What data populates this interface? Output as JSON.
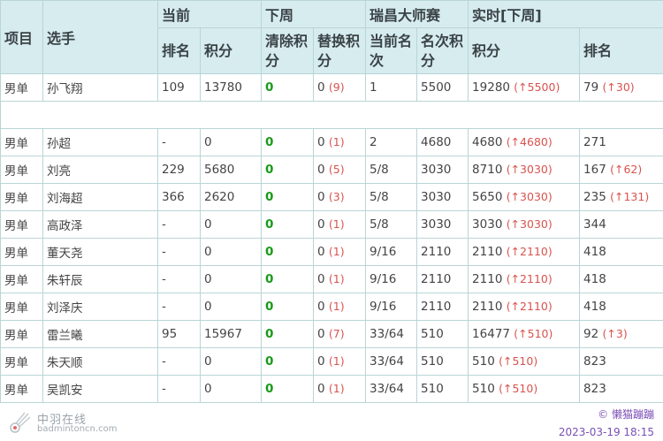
{
  "header": {
    "group_current": "当前",
    "group_nextweek": "下周",
    "group_tournament": "瑞昌大师赛",
    "group_realtime": "实时[下周]",
    "col_event": "项目",
    "col_player": "选手",
    "col_rank": "排名",
    "col_points": "积分",
    "col_clear": "清除积分",
    "col_replace": "替换积分",
    "col_curround": "当前名次",
    "col_roundpts": "名次积分",
    "col_rt_points": "积分",
    "col_rt_rank": "排名"
  },
  "rows": [
    {
      "event": "男单",
      "player": "孙飞翔",
      "rank": "109",
      "points": "13780",
      "clear": "0",
      "replace": "0",
      "replace_paren": "(9)",
      "round": "1",
      "round_pts": "5500",
      "rt_points": "19280",
      "rt_points_delta": "(↑5500)",
      "rt_rank": "79",
      "rt_rank_delta": "(↑30)"
    },
    {
      "event": "男单",
      "player": "孙超",
      "rank": "-",
      "points": "0",
      "clear": "0",
      "replace": "0",
      "replace_paren": "(1)",
      "round": "2",
      "round_pts": "4680",
      "rt_points": "4680",
      "rt_points_delta": "(↑4680)",
      "rt_rank": "271",
      "rt_rank_delta": ""
    },
    {
      "event": "男单",
      "player": "刘亮",
      "rank": "229",
      "points": "5680",
      "clear": "0",
      "replace": "0",
      "replace_paren": "(5)",
      "round": "5/8",
      "round_pts": "3030",
      "rt_points": "8710",
      "rt_points_delta": "(↑3030)",
      "rt_rank": "167",
      "rt_rank_delta": "(↑62)"
    },
    {
      "event": "男单",
      "player": "刘海超",
      "rank": "366",
      "points": "2620",
      "clear": "0",
      "replace": "0",
      "replace_paren": "(3)",
      "round": "5/8",
      "round_pts": "3030",
      "rt_points": "5650",
      "rt_points_delta": "(↑3030)",
      "rt_rank": "235",
      "rt_rank_delta": "(↑131)"
    },
    {
      "event": "男单",
      "player": "高政泽",
      "rank": "-",
      "points": "0",
      "clear": "0",
      "replace": "0",
      "replace_paren": "(1)",
      "round": "5/8",
      "round_pts": "3030",
      "rt_points": "3030",
      "rt_points_delta": "(↑3030)",
      "rt_rank": "344",
      "rt_rank_delta": ""
    },
    {
      "event": "男单",
      "player": "董天尧",
      "rank": "-",
      "points": "0",
      "clear": "0",
      "replace": "0",
      "replace_paren": "(1)",
      "round": "9/16",
      "round_pts": "2110",
      "rt_points": "2110",
      "rt_points_delta": "(↑2110)",
      "rt_rank": "418",
      "rt_rank_delta": ""
    },
    {
      "event": "男单",
      "player": "朱轩辰",
      "rank": "-",
      "points": "0",
      "clear": "0",
      "replace": "0",
      "replace_paren": "(1)",
      "round": "9/16",
      "round_pts": "2110",
      "rt_points": "2110",
      "rt_points_delta": "(↑2110)",
      "rt_rank": "418",
      "rt_rank_delta": ""
    },
    {
      "event": "男单",
      "player": "刘泽庆",
      "rank": "-",
      "points": "0",
      "clear": "0",
      "replace": "0",
      "replace_paren": "(1)",
      "round": "9/16",
      "round_pts": "2110",
      "rt_points": "2110",
      "rt_points_delta": "(↑2110)",
      "rt_rank": "418",
      "rt_rank_delta": ""
    },
    {
      "event": "男单",
      "player": "雷兰曦",
      "rank": "95",
      "points": "15967",
      "clear": "0",
      "replace": "0",
      "replace_paren": "(7)",
      "round": "33/64",
      "round_pts": "510",
      "rt_points": "16477",
      "rt_points_delta": "(↑510)",
      "rt_rank": "92",
      "rt_rank_delta": "(↑3)"
    },
    {
      "event": "男单",
      "player": "朱天顺",
      "rank": "-",
      "points": "0",
      "clear": "0",
      "replace": "0",
      "replace_paren": "(1)",
      "round": "33/64",
      "round_pts": "510",
      "rt_points": "510",
      "rt_points_delta": "(↑510)",
      "rt_rank": "823",
      "rt_rank_delta": ""
    },
    {
      "event": "男单",
      "player": "吴凯安",
      "rank": "-",
      "points": "0",
      "clear": "0",
      "replace": "0",
      "replace_paren": "(1)",
      "round": "33/64",
      "round_pts": "510",
      "rt_points": "510",
      "rt_points_delta": "(↑510)",
      "rt_rank": "823",
      "rt_rank_delta": ""
    }
  ],
  "footer": {
    "logo_cn": "中羽在线",
    "logo_en": "badmintoncn.com",
    "credit": "© 懒猫蹦蹦",
    "timestamp": "2023-03-19 18:15"
  },
  "colors": {
    "header_bg": "#d6ecee",
    "border": "#b9d5d7",
    "green": "#1a9a1a",
    "red_delta": "#d9534f",
    "credit": "#7a4fb5"
  }
}
